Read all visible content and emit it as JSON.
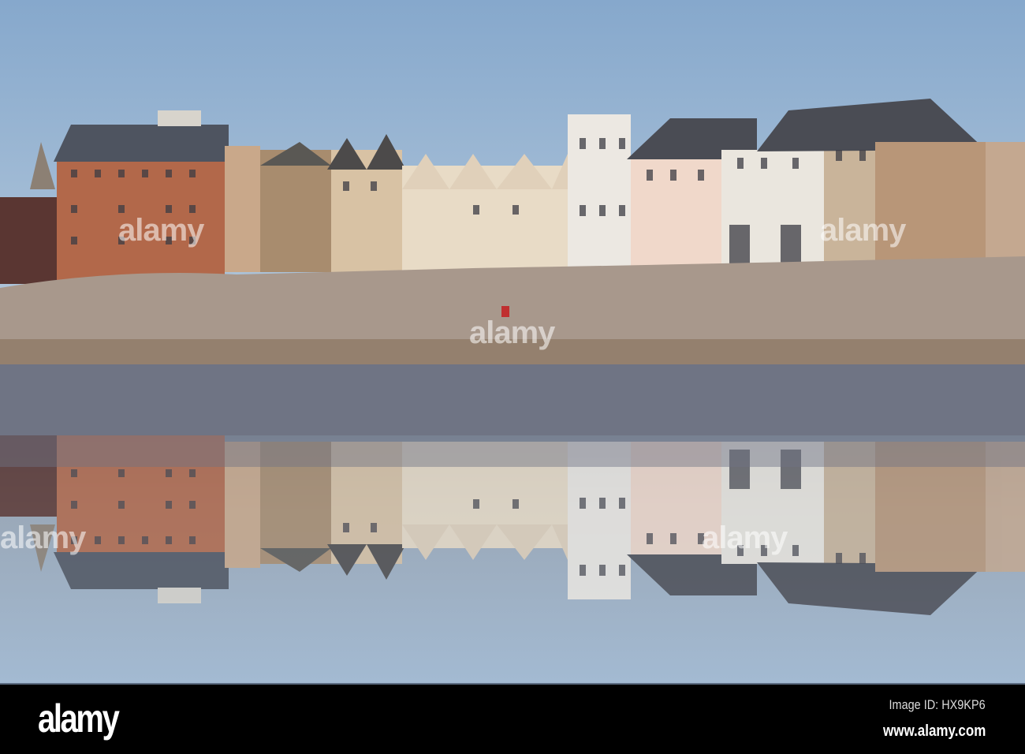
{
  "photo": {
    "subject": "seafront terrace reflected in tidal pool"
  },
  "watermark": {
    "text": "alamy"
  },
  "footer": {
    "logo": "alamy",
    "image_id": "Image ID: HX9KP6",
    "url": "www.alamy.com"
  },
  "colors": {
    "sky_top": "#86a8cc",
    "sky_bottom": "#c2d2e0",
    "water": "#9db3cc",
    "rocks": "#a8988c",
    "mud": "#6f7484"
  }
}
